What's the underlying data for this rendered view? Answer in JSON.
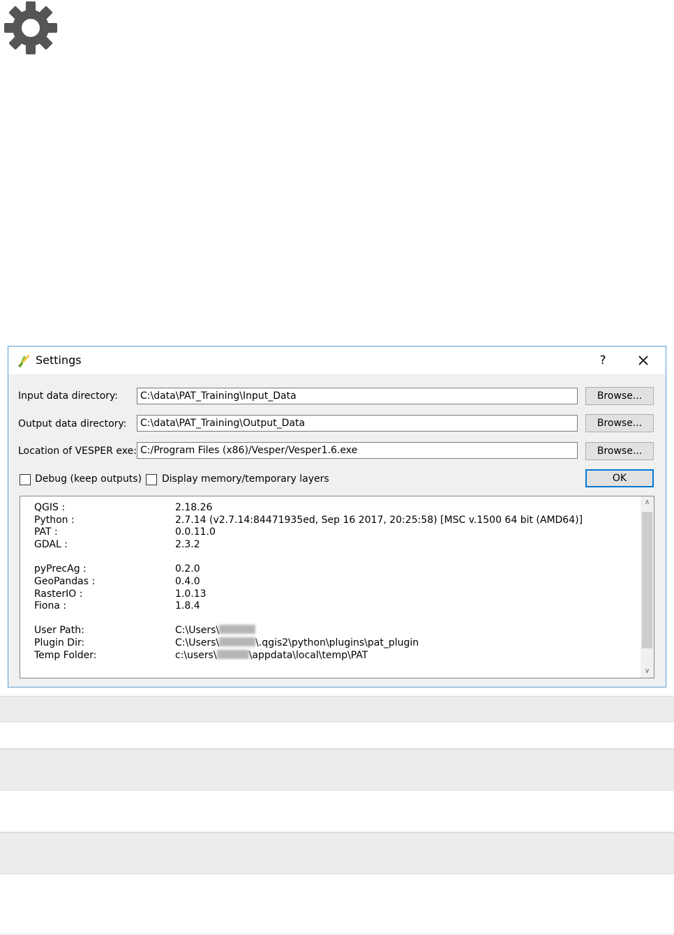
{
  "gear_icon": "gear-icon",
  "dialog": {
    "title": "Settings",
    "help_label": "?",
    "fields": [
      {
        "label": "Input data directory:",
        "value": "C:\\data\\PAT_Training\\Input_Data",
        "button": "Browse..."
      },
      {
        "label": "Output data directory:",
        "value": "C:\\data\\PAT_Training\\Output_Data",
        "button": "Browse..."
      },
      {
        "label": "Location of VESPER exe:",
        "value": "C:/Program Files (x86)/Vesper/Vesper1.6.exe",
        "button": "Browse..."
      }
    ],
    "debug_label": "Debug (keep outputs)",
    "display_label": "Display memory/temporary layers",
    "ok_label": "OK",
    "info": [
      {
        "key": "QGIS :",
        "value": "2.18.26"
      },
      {
        "key": "Python :",
        "value": "2.7.14 (v2.7.14:84471935ed, Sep 16 2017, 20:25:58) [MSC v.1500 64 bit (AMD64)]"
      },
      {
        "key": "PAT :",
        "value": "0.0.11.0"
      },
      {
        "key": "GDAL :",
        "value": "2.3.2"
      },
      {
        "key": "pyPrecAg :",
        "value": "0.2.0"
      },
      {
        "key": "GeoPandas :",
        "value": "0.4.0"
      },
      {
        "key": "RasterIO :",
        "value": "1.0.13"
      },
      {
        "key": "Fiona :",
        "value": "1.8.4"
      },
      {
        "key": "User Path:",
        "value": "C:\\Users\\"
      },
      {
        "key": "Plugin Dir:",
        "value": "C:\\Users\\",
        "value_suffix": "\\.qgis2\\python\\plugins\\pat_plugin"
      },
      {
        "key": "Temp Folder:",
        "value": "c:\\users\\",
        "value_suffix": "\\appdata\\local\\temp\\PAT"
      }
    ]
  },
  "colors": {
    "accent": "#0078d7",
    "border": "#5b9bd5"
  }
}
